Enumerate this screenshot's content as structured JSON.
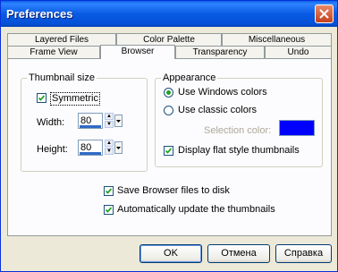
{
  "window": {
    "title": "Preferences"
  },
  "tabs": {
    "row_back": [
      "Layered Files",
      "Color Palette",
      "Miscellaneous"
    ],
    "row_front": [
      "Frame View",
      "Browser",
      "Transparency",
      "Undo"
    ],
    "active": "Browser"
  },
  "thumbnail": {
    "group_title": "Thumbnail size",
    "symmetric_label": "Symmetric",
    "symmetric_checked": true,
    "width_label": "Width:",
    "width_value": "80",
    "height_label": "Height:",
    "height_value": "80"
  },
  "appearance": {
    "group_title": "Appearance",
    "windows_colors_label": "Use Windows colors",
    "classic_colors_label": "Use classic colors",
    "selected": "windows",
    "selection_color_label": "Selection color:",
    "selection_color": "#0000ff",
    "flat_thumbs_label": "Display flat style thumbnails",
    "flat_thumbs_checked": true
  },
  "options": {
    "save_browser_label": "Save Browser files to disk",
    "save_browser_checked": true,
    "auto_update_label": "Automatically update the thumbnails",
    "auto_update_checked": true
  },
  "buttons": {
    "ok": "OK",
    "cancel": "Отмена",
    "help": "Справка"
  }
}
